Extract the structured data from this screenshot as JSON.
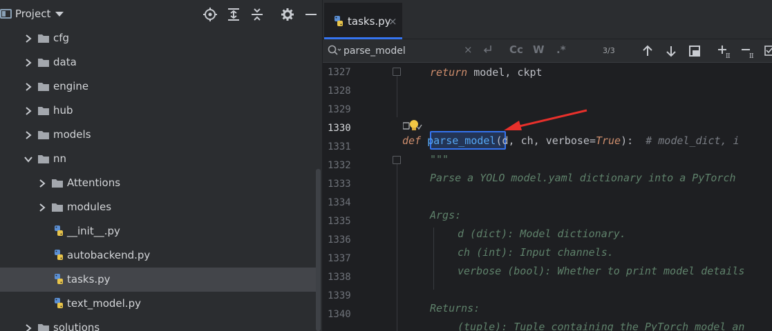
{
  "project_panel": {
    "title": "Project",
    "tree": [
      {
        "label": "cfg",
        "type": "folder",
        "depth": 0,
        "expanded": false
      },
      {
        "label": "data",
        "type": "folder",
        "depth": 0,
        "expanded": false
      },
      {
        "label": "engine",
        "type": "folder",
        "depth": 0,
        "expanded": false
      },
      {
        "label": "hub",
        "type": "folder",
        "depth": 0,
        "expanded": false
      },
      {
        "label": "models",
        "type": "folder",
        "depth": 0,
        "expanded": false
      },
      {
        "label": "nn",
        "type": "folder",
        "depth": 0,
        "expanded": true
      },
      {
        "label": "Attentions",
        "type": "folder",
        "depth": 1,
        "expanded": false
      },
      {
        "label": "modules",
        "type": "folder",
        "depth": 1,
        "expanded": false
      },
      {
        "label": "__init__.py",
        "type": "python-file",
        "depth": 1
      },
      {
        "label": "autobackend.py",
        "type": "python-file",
        "depth": 1
      },
      {
        "label": "tasks.py",
        "type": "python-file",
        "depth": 1,
        "selected": true
      },
      {
        "label": "text_model.py",
        "type": "python-file",
        "depth": 1
      },
      {
        "label": "solutions",
        "type": "folder",
        "depth": 0,
        "expanded": false
      }
    ],
    "header_icons": [
      "locate-icon",
      "expand-all-icon",
      "collapse-all-icon",
      "gear-icon",
      "minimize-icon"
    ]
  },
  "editor": {
    "tab": {
      "label": "tasks.py",
      "close": "×"
    },
    "find": {
      "query": "parse_model",
      "clear": "×",
      "match_case": "Cc",
      "whole_words": "W",
      "regex": ".*",
      "count": "3/3"
    },
    "lines": [
      {
        "num": "1327",
        "text": "return model, ckpt"
      },
      {
        "num": "1328",
        "text": ""
      },
      {
        "num": "1329",
        "text": ""
      },
      {
        "num": "1330",
        "text": "def parse_model(d, ch, verbose=True):  # model_dict, i"
      },
      {
        "num": "1331",
        "text": "\"\"\""
      },
      {
        "num": "1332",
        "text": "Parse a YOLO model.yaml dictionary into a PyTorch"
      },
      {
        "num": "1333",
        "text": ""
      },
      {
        "num": "1334",
        "text": "Args:"
      },
      {
        "num": "1335",
        "text": "d (dict): Model dictionary."
      },
      {
        "num": "1336",
        "text": "ch (int): Input channels."
      },
      {
        "num": "1337",
        "text": "verbose (bool): Whether to print model details"
      },
      {
        "num": "1338",
        "text": ""
      },
      {
        "num": "1339",
        "text": "Returns:"
      },
      {
        "num": "1340",
        "text": "(tuple): Tuple containing the PyTorch model an"
      }
    ],
    "current_line": "1330",
    "tokens": {
      "l1327_kw": "return",
      "l1327_rest": " model, ckpt",
      "l1330_def": "def",
      "l1330_fn": "parse_model",
      "l1330_args1": "(d, ch, verbose=",
      "l1330_true": "True",
      "l1330_args2": "):  ",
      "l1330_cmt": "# model_dict, i"
    }
  }
}
